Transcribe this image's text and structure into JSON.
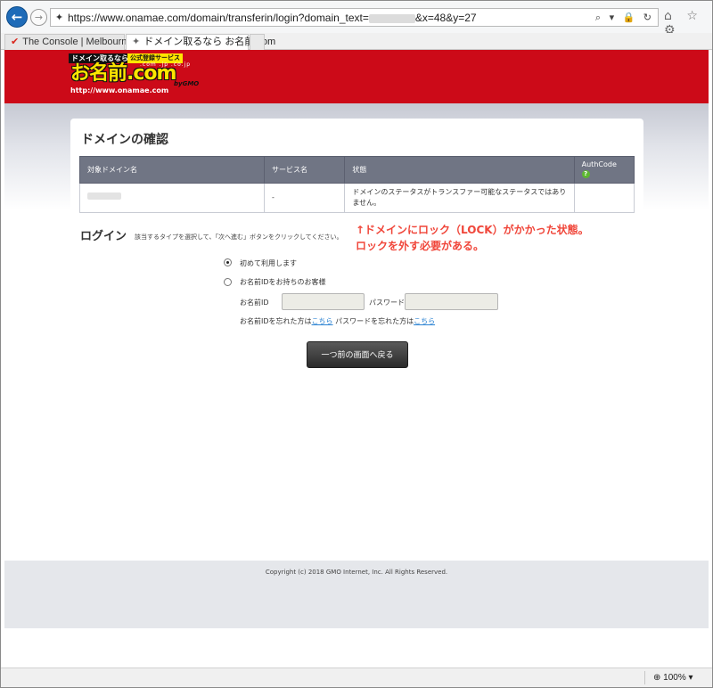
{
  "browser": {
    "url_prefix": "https://www.onamae.com/domain/transferin/login?domain_text=",
    "url_suffix": "&x=48&y=27",
    "url_tools": "⌕ ▾ 🔒 ↻",
    "icons": [
      "home-icon",
      "star-icon",
      "gear-icon"
    ],
    "icons_text": "⌂ ☆ ⚙",
    "tabs": [
      {
        "label": "The Console | Melbourne IT"
      },
      {
        "label": "ドメイン取るなら お名前.com"
      }
    ],
    "zoom": "100%"
  },
  "logo": {
    "tag1": "ドメイン取るなら",
    "tag2": "公式登録サービス",
    "tlds": ".com .jp .co.jp",
    "main": "お名前.com",
    "url": "http://www.onamae.com",
    "gmo": "byGMO"
  },
  "panel": {
    "title": "ドメインの確認",
    "table": {
      "headers": [
        "対象ドメイン名",
        "サービス名",
        "状態",
        "AuthCode"
      ],
      "rows": [
        {
          "service": "-",
          "status": "ドメインのステータスがトランスファー可能なステータスではありません。",
          "authcode": ""
        }
      ]
    }
  },
  "login": {
    "heading": "ログイン",
    "description": "該当するタイプを選択して、「次へ進む」ボタンをクリックしてください。",
    "options": [
      {
        "label": "初めて利用します",
        "checked": true
      },
      {
        "label": "お名前IDをお持ちのお客様",
        "checked": false
      }
    ],
    "id_label": "お名前ID",
    "password_label": "パスワード",
    "forgot_id_text": "お名前IDを忘れた方は",
    "forgot_link": "こちら",
    "forgot_pw_text": "パスワードを忘れた方は",
    "back_button": "一つ前の画面へ戻る"
  },
  "annotation": {
    "line1": "↑ドメインにロック（LOCK）がかかった状態。",
    "line2": "ロックを外す必要がある。",
    "color": "#f0463a"
  },
  "footer": {
    "copyright": "Copyright (c) 2018 GMO Internet, Inc. All Rights Reserved."
  },
  "colors": {
    "header_red": "#cc0a18",
    "table_header": "#707584",
    "link": "#2a82d2"
  }
}
